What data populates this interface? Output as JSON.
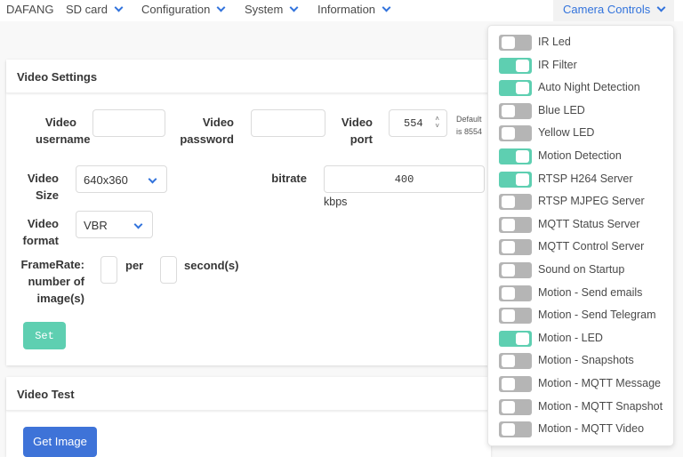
{
  "nav": {
    "brand": "DAFANG",
    "items": [
      "SD card",
      "Configuration",
      "System",
      "Information"
    ],
    "camera_controls": "Camera Controls"
  },
  "video_settings": {
    "title": "Video Settings",
    "username_label": "Video username",
    "username_value": "",
    "password_label": "Video password",
    "password_value": "",
    "port_label": "Video port",
    "port_value": "554",
    "port_hint": "Default is 8554",
    "size_label": "Video Size",
    "size_value": "640x360",
    "bitrate_label": "bitrate",
    "bitrate_value": "400",
    "bitrate_unit": "kbps",
    "format_label": "Video format",
    "format_value": "VBR",
    "framerate_label": "FrameRate: number of image(s)",
    "framerate_images": "",
    "per_label": "per",
    "framerate_seconds": "",
    "seconds_label": "second(s)",
    "set_button": "Set"
  },
  "video_test": {
    "title": "Video Test",
    "get_image_button": "Get Image"
  },
  "colors": {
    "accent": "#3273dc",
    "toggle_on": "#5ecfb1",
    "toggle_off": "#b5b5b5"
  },
  "camera_controls": [
    {
      "label": "IR Led",
      "on": false
    },
    {
      "label": "IR Filter",
      "on": true
    },
    {
      "label": "Auto Night Detection",
      "on": true
    },
    {
      "label": "Blue LED",
      "on": false
    },
    {
      "label": "Yellow LED",
      "on": false
    },
    {
      "label": "Motion Detection",
      "on": true
    },
    {
      "label": "RTSP H264 Server",
      "on": true
    },
    {
      "label": "RTSP MJPEG Server",
      "on": false
    },
    {
      "label": "MQTT Status Server",
      "on": false
    },
    {
      "label": "MQTT Control Server",
      "on": false
    },
    {
      "label": "Sound on Startup",
      "on": false
    },
    {
      "label": "Motion - Send emails",
      "on": false
    },
    {
      "label": "Motion - Send Telegram",
      "on": false
    },
    {
      "label": "Motion - LED",
      "on": true
    },
    {
      "label": "Motion - Snapshots",
      "on": false
    },
    {
      "label": "Motion - MQTT Message",
      "on": false
    },
    {
      "label": "Motion - MQTT Snapshot",
      "on": false
    },
    {
      "label": "Motion - MQTT Video",
      "on": false
    }
  ]
}
